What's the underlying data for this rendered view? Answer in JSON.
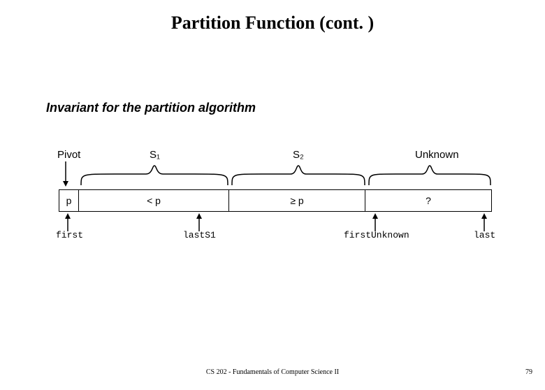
{
  "title": "Partition Function (cont. )",
  "subtitle": "Invariant for the partition algorithm",
  "segments": {
    "pivot_label": "Pivot",
    "s1_label": "S₁",
    "s2_label": "S₂",
    "unknown_label": "Unknown"
  },
  "cells": {
    "pivot": "p",
    "s1": "< p",
    "s2": "≥ p",
    "unknown": "?"
  },
  "pointers": {
    "first": "first",
    "lastS1": "lastS1",
    "firstUnknown": "firstUnknown",
    "last": "last"
  },
  "footer": "CS 202 - Fundamentals of Computer Science II",
  "page_number": "79"
}
